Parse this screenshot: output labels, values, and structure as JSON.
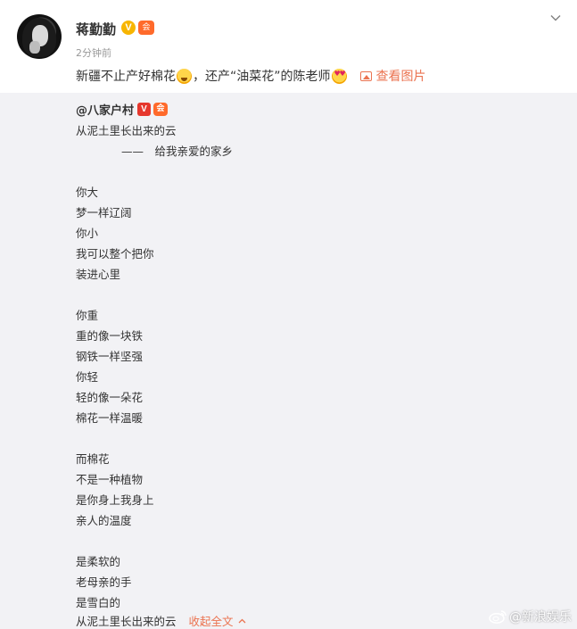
{
  "post": {
    "author": "蒋勤勤",
    "vip_badge": "V",
    "member_badge": "会",
    "timestamp": "2分钟前",
    "caption_part1": "新疆不止产好棉花",
    "caption_part2": "，还产“油菜花”的陈老师",
    "view_image_label": "查看图片"
  },
  "repost": {
    "author": "@八家户村",
    "verified_badge": "V",
    "member_badge": "会",
    "lines": [
      "从泥土里长出来的云",
      "——　给我亲爱的家乡",
      "",
      "你大",
      "梦一样辽阔",
      "你小",
      "我可以整个把你",
      "装进心里",
      "",
      "你重",
      "重的像一块铁",
      "钢铁一样坚强",
      "你轻",
      "轻的像一朵花",
      "棉花一样温暖",
      "",
      "而棉花",
      "不是一种植物",
      "是你身上我身上",
      "亲人的温度",
      "",
      "是柔软的",
      "老母亲的手",
      "是雪白的"
    ],
    "last_line": "从泥土里长出来的云",
    "collapse_label": "收起全文"
  },
  "watermark": "@新浪娱乐",
  "icons": {
    "chevron": "chevron-down-icon",
    "image": "image-icon",
    "collapse": "chevron-up-icon"
  },
  "colors": {
    "accent": "#eb7350",
    "repost_bg": "#f2f2f5"
  }
}
